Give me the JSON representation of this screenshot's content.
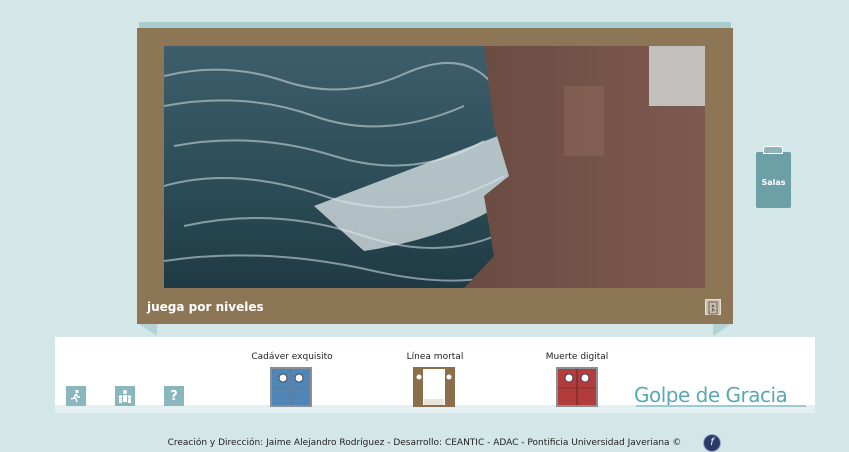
{
  "viewer": {
    "caption": "juega por niveles",
    "exit_icon": "exit-icon"
  },
  "side": {
    "salas_label": "Salas",
    "icon": "clipboard-icon"
  },
  "toolbar": {
    "buttons": [
      {
        "icon": "exit-run-icon",
        "glyph": "🏃"
      },
      {
        "icon": "people-icon",
        "glyph": "👪"
      },
      {
        "icon": "help-icon",
        "glyph": "?"
      }
    ]
  },
  "doors": [
    {
      "label": "Cadáver exquisito",
      "color": "#4f86b7",
      "state": "closed"
    },
    {
      "label": "Línea mortal",
      "color": "#8c6f4a",
      "state": "open"
    },
    {
      "label": "Muerte digital",
      "color": "#b23b3b",
      "state": "closed"
    }
  ],
  "logo": {
    "text": "Golpe de Gracia"
  },
  "footer": {
    "credits": "Creación y Dirección: Jaime Alejandro Rodríguez - Desarrollo: CEANTIC - ADAC - Pontificia Universidad Javeriana ©",
    "flash_icon": "flash-player-icon"
  }
}
